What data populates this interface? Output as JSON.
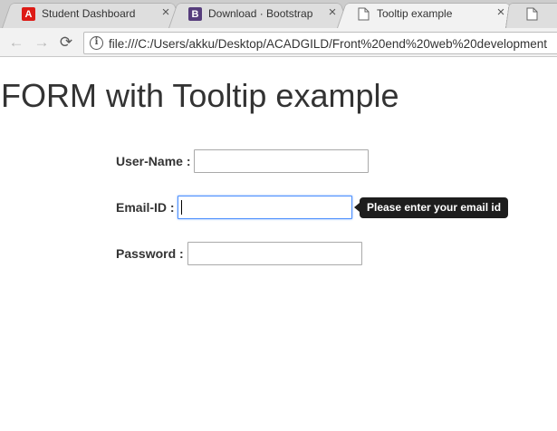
{
  "browser": {
    "tabs": [
      {
        "title": "Student Dashboard",
        "favicon": "angular-icon",
        "favicon_glyph": "A",
        "active": false
      },
      {
        "title": "Download · Bootstrap",
        "favicon": "bootstrap-icon",
        "favicon_glyph": "B",
        "active": false
      },
      {
        "title": "Tooltip example",
        "favicon": "page-icon",
        "active": true
      },
      {
        "title": "",
        "favicon": "page-icon",
        "active": false
      }
    ],
    "close_glyph": "×",
    "nav": {
      "back_glyph": "←",
      "forward_glyph": "→",
      "reload_glyph": "⟳"
    },
    "address": {
      "info_glyph": "i",
      "url": "file:///C:/Users/akku/Desktop/ACADGILD/Front%20end%20web%20development"
    }
  },
  "page": {
    "title": "FORM with Tooltip example",
    "fields": [
      {
        "label": "User-Name :",
        "value": ""
      },
      {
        "label": "Email-ID :",
        "value": "",
        "focused": true
      },
      {
        "label": "Password :",
        "value": ""
      }
    ],
    "tooltip": {
      "text": "Please enter your email id"
    }
  },
  "colors": {
    "angular_red": "#dd1b16",
    "bootstrap_purple": "#563d7c",
    "tooltip_bg": "#1d1d1d",
    "focus_blue": "#4d90fe"
  }
}
